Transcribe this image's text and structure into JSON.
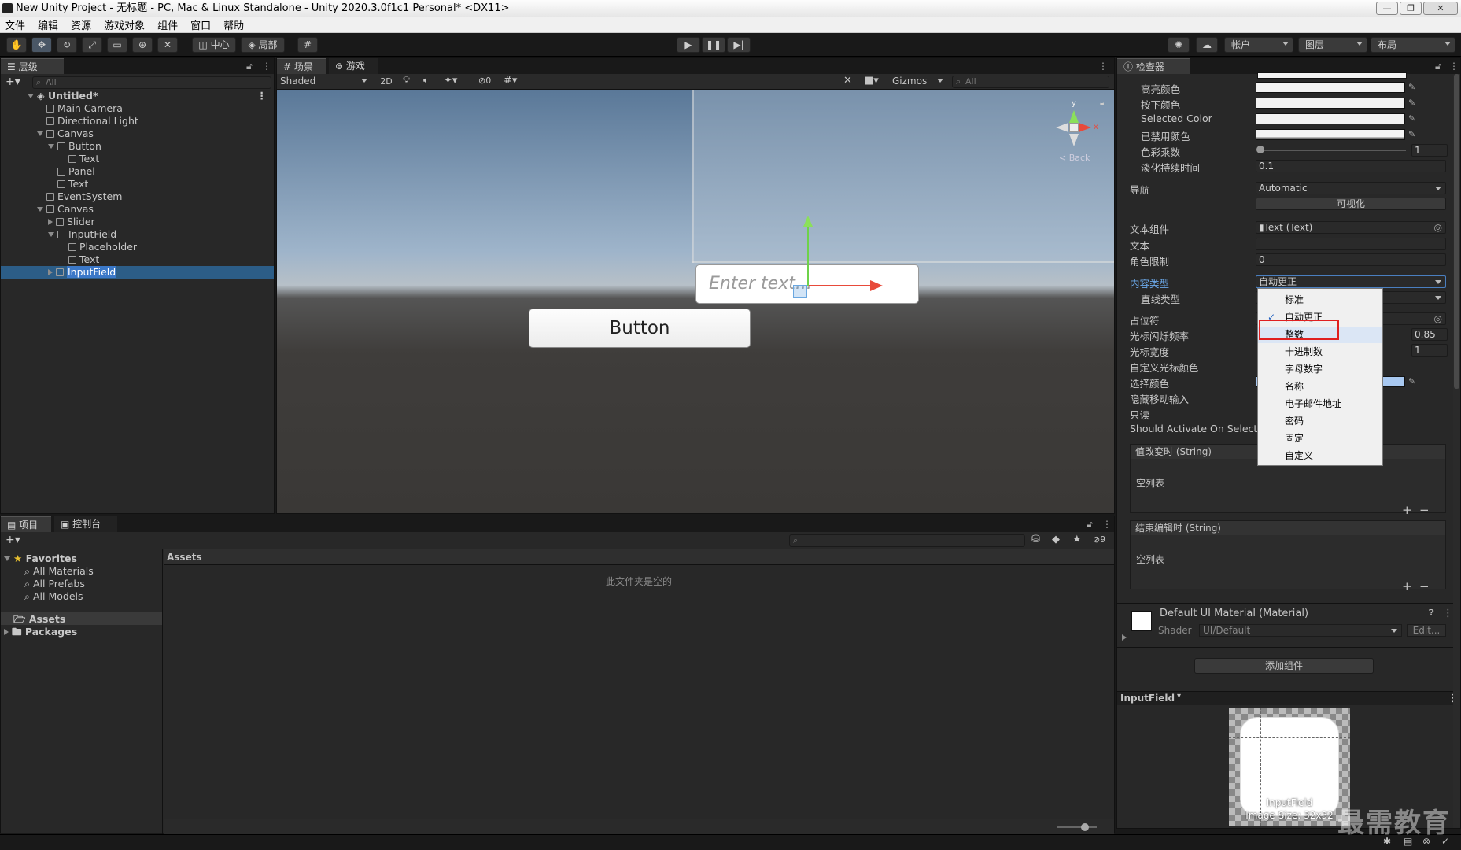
{
  "window": {
    "title": "New Unity Project - 无标题 - PC, Mac & Linux Standalone - Unity 2020.3.0f1c1 Personal* <DX11>",
    "controls": [
      "—",
      "❐",
      "✕"
    ]
  },
  "menu": [
    "文件",
    "编辑",
    "资源",
    "游戏对象",
    "组件",
    "窗口",
    "帮助"
  ],
  "toolbar": {
    "pivot_label": "中心",
    "space_label": "局部",
    "account_label": "帐户",
    "layers_label": "图层",
    "layout_label": "布局"
  },
  "hierarchy": {
    "tab": "层级",
    "search_placeholder": "All",
    "scene": "Untitled*",
    "items": [
      {
        "label": "Main Camera",
        "depth": 1,
        "expand": "none"
      },
      {
        "label": "Directional Light",
        "depth": 1,
        "expand": "none"
      },
      {
        "label": "Canvas",
        "depth": 1,
        "expand": "open"
      },
      {
        "label": "Button",
        "depth": 2,
        "expand": "open"
      },
      {
        "label": "Text",
        "depth": 3,
        "expand": "none"
      },
      {
        "label": "Panel",
        "depth": 2,
        "expand": "none"
      },
      {
        "label": "Text",
        "depth": 2,
        "expand": "none"
      },
      {
        "label": "EventSystem",
        "depth": 1,
        "expand": "none"
      },
      {
        "label": "Canvas",
        "depth": 1,
        "expand": "open"
      },
      {
        "label": "Slider",
        "depth": 2,
        "expand": "closed"
      },
      {
        "label": "InputField",
        "depth": 2,
        "expand": "open"
      },
      {
        "label": "Placeholder",
        "depth": 3,
        "expand": "none"
      },
      {
        "label": "Text",
        "depth": 3,
        "expand": "none"
      },
      {
        "label": "InputField",
        "depth": 2,
        "expand": "closed",
        "selected": true
      }
    ]
  },
  "scene": {
    "tab_scene": "场景",
    "tab_game": "游戏",
    "shading": "Shaded",
    "mode_2d": "2D",
    "hidden_count": "0",
    "gizmos": "Gizmos",
    "search_placeholder": "All",
    "view_label": "< Back",
    "axis_x": "x",
    "axis_y": "y",
    "input_placeholder": "Enter text...",
    "button_text": "Button"
  },
  "inspector": {
    "tab": "检查器",
    "colors": [
      {
        "label": "高亮颜色"
      },
      {
        "label": "按下颜色"
      },
      {
        "label": "Selected Color"
      },
      {
        "label": "已禁用颜色"
      }
    ],
    "color_multiplier_label": "色彩乘数",
    "color_multiplier_value": "1",
    "fade_label": "淡化持续时间",
    "fade_value": "0.1",
    "nav_label": "导航",
    "nav_value": "Automatic",
    "visualize": "可视化",
    "text_component_label": "文本组件",
    "text_component_value": "Text (Text)",
    "text_label": "文本",
    "char_limit_label": "角色限制",
    "char_limit_value": "0",
    "content_type_label": "内容类型",
    "content_type_value": "自动更正",
    "line_type_label": "直线类型",
    "placeholder_label": "占位符",
    "blink_label": "光标闪烁频率",
    "blink_value": "0.85",
    "caret_width_label": "光标宽度",
    "caret_width_value": "1",
    "custom_caret_label": "自定义光标颜色",
    "selection_color_label": "选择颜色",
    "hide_mobile_label": "隐藏移动输入",
    "readonly_label": "只读",
    "activate_label": "Should Activate On Select",
    "on_value_changed": "值改变时 (String)",
    "on_end_edit": "结束编辑时 (String)",
    "empty_list": "空列表",
    "material_name": "Default UI Material (Material)",
    "shader_label": "Shader",
    "shader_value": "UI/Default",
    "edit_label": "Edit...",
    "add_component": "添加组件",
    "preview_title": "InputField",
    "preview_name": "InputField",
    "preview_size": "Image Size: 32x32"
  },
  "content_type_popup": {
    "options": [
      "标准",
      "自动更正",
      "整数",
      "十进制数",
      "字母数字",
      "名称",
      "电子邮件地址",
      "密码",
      "固定",
      "自定义"
    ],
    "checked": "自动更正",
    "highlighted": "整数"
  },
  "project": {
    "tab_project": "项目",
    "tab_console": "控制台",
    "favorites": "Favorites",
    "fav_items": [
      "All Materials",
      "All Prefabs",
      "All Models"
    ],
    "assets": "Assets",
    "packages": "Packages",
    "breadcrumb": "Assets",
    "empty_msg": "此文件夹是空的",
    "hidden_count": "9"
  },
  "watermark": "最需教育"
}
